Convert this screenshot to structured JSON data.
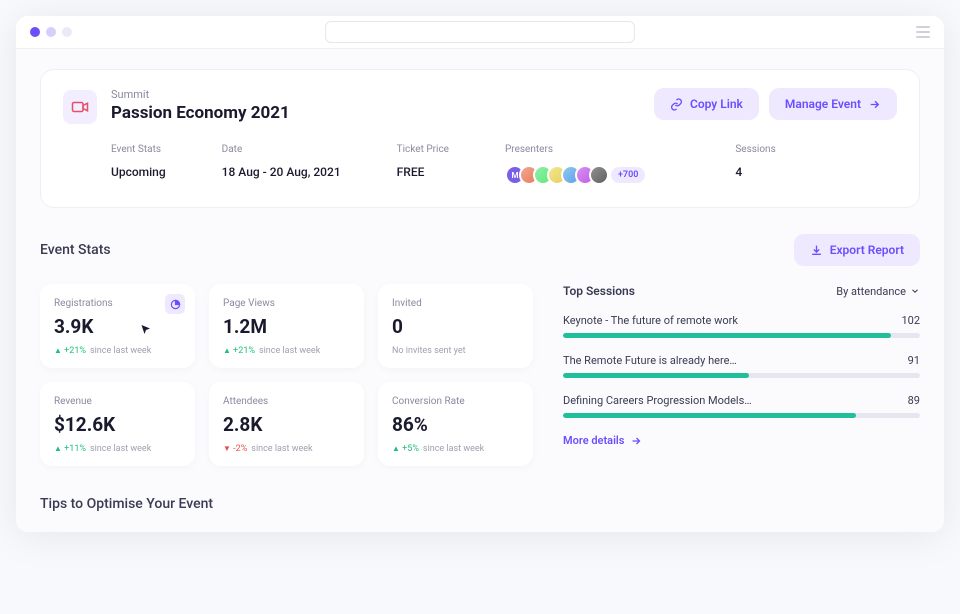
{
  "header": {
    "subtitle": "Summit",
    "title": "Passion Economy 2021",
    "copy_link": "Copy Link",
    "manage_event": "Manage Event",
    "stats": {
      "event_stats_label": "Event Stats",
      "event_stats_value": "Upcoming",
      "date_label": "Date",
      "date_value": "18 Aug - 20 Aug, 2021",
      "ticket_label": "Ticket Price",
      "ticket_value": "FREE",
      "presenters_label": "Presenters",
      "presenters_more": "+700",
      "sessions_label": "Sessions",
      "sessions_value": "4"
    }
  },
  "stats_section": {
    "title": "Event Stats",
    "export": "Export Report",
    "cards": [
      {
        "label": "Registrations",
        "value": "3.9K",
        "delta": "+21%",
        "dir": "up",
        "since": "since last week",
        "has_icon": true
      },
      {
        "label": "Page Views",
        "value": "1.2M",
        "delta": "+21%",
        "dir": "up",
        "since": "since last week"
      },
      {
        "label": "Invited",
        "value": "0",
        "note": "No invites sent yet"
      },
      {
        "label": "Revenue",
        "value": "$12.6K",
        "delta": "+11%",
        "dir": "up",
        "since": "since last week"
      },
      {
        "label": "Attendees",
        "value": "2.8K",
        "delta": "-2%",
        "dir": "down",
        "since": "since last week"
      },
      {
        "label": "Conversion Rate",
        "value": "86%",
        "delta": "+5%",
        "dir": "up",
        "since": "since last week"
      }
    ]
  },
  "top_sessions": {
    "title": "Top Sessions",
    "sort": "By attendance",
    "rows": [
      {
        "name": "Keynote - The future of remote work",
        "count": "102",
        "pct": 92
      },
      {
        "name": "The Remote Future is already here…",
        "count": "91",
        "pct": 52
      },
      {
        "name": "Defining Careers Progression Models…",
        "count": "89",
        "pct": 82
      }
    ],
    "more": "More details"
  },
  "tips_title": "Tips to Optimise Your Event"
}
